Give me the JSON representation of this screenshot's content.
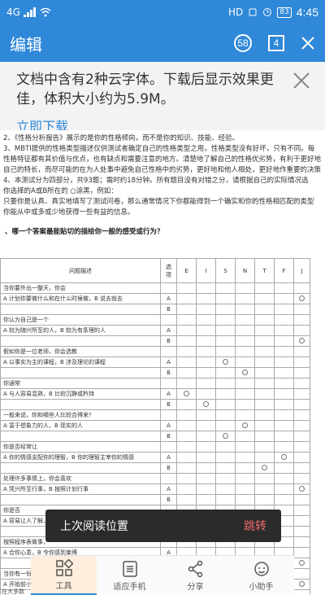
{
  "status_bar": {
    "carrier": "4G",
    "hd": "HD",
    "battery": "83",
    "time": "4:45"
  },
  "topbar": {
    "title": "编辑",
    "notif_count": "58",
    "page_count": "4"
  },
  "banner": {
    "message": "文档中含有2种云字体。下载后显示效果更佳，体积大小约为5.9M。",
    "download": "立即下载"
  },
  "doc": {
    "lines": [
      "2、《性格分析报告》展示的是你的性格倾向，而不是你的知识、技能、经验。",
      "3、MBTI提供的性格类型描述仅供测试者确定自己的性格类型之用，性格类型没有好坏，只有不同。每",
      "性格特征都有其价值与优点，也有缺点和需要注意的地方。清楚地了解自己的性格优劣势，有利于更好地",
      "自己的特长，而尽可能的在为人处事中避免自己性格中的劣势，更好地和他人相处，更好地作重要的决策",
      "4、本测试分为四部分，共93题；需时约18分钟。所有题目没有对错之分，请根据自己的实际情况选",
      "你选择的A或B所在的 ○涂黑，例如：",
      "只要你是认真、真实地填写了测试问卷，那么通常情况下你都能得到一个确实和你的性格相匹配的类型",
      "你能从中或多或少地获得一些有益的信息。"
    ],
    "question_title": "、哪一个答案最能贴切的描绘你一般的感受或行为？",
    "table_header": [
      "问题描述",
      "选项",
      "E",
      "I",
      "S",
      "N",
      "T",
      "F",
      "J"
    ],
    "rows": [
      {
        "q": "当你要外出一整天，你会",
        "a": "A 计划你要做什么和在什么时候做，B 说去就去",
        "marks": [
          8,
          null
        ]
      },
      {
        "q": "你认为自己是一个",
        "a": "A 较为随兴所至的人，B 较为有条理的人",
        "marks": [
          null,
          8
        ]
      },
      {
        "q": "假如你是一位老师，你会选教",
        "a": "A 以事实为主的课程，B 涉及理论的课程",
        "marks": [
          4,
          5
        ]
      },
      {
        "q": "你通常",
        "a": "A 与人容易混熟，B 比较沉静或矜持",
        "marks": [
          2,
          3
        ]
      },
      {
        "q": "一般来说，你和哪些人比较合得来?",
        "a": "A 富于想象力的人，B 现实的人",
        "marks": [
          5,
          4
        ]
      },
      {
        "q": "你是否经常让",
        "a": "A 你的情感支配你的理智，B 你的理智主宰你的情感",
        "marks": [
          7,
          6
        ]
      },
      {
        "q": "处理许多事情上，你会喜欢",
        "a": "A 凭兴所至行事，B 按照计划行事",
        "marks": [
          8,
          null
        ]
      },
      {
        "q": "你是否",
        "a": "A 容易让人了解，或是 B 难于让人了解",
        "marks": [
          2,
          3
        ]
      },
      {
        "q": "按照程序表做事，",
        "a": "A 合你心意，B 令你感到束缚",
        "marks": [
          null,
          8
        ]
      },
      {
        "q": "当你有一份特别的任务，你会喜欢",
        "a": "A 开始前小心组织计划，B 边做边找须做什么",
        "marks": [
          8,
          null
        ]
      }
    ],
    "footer_fragment": "在大多数"
  },
  "toast": {
    "text": "上次阅读位置",
    "action": "跳转"
  },
  "bottom_tabs": [
    {
      "label": "工具",
      "icon": "tools-icon"
    },
    {
      "label": "适应手机",
      "icon": "fit-phone-icon"
    },
    {
      "label": "分享",
      "icon": "share-icon"
    },
    {
      "label": "小助手",
      "icon": "assistant-icon"
    }
  ],
  "colors": {
    "primary": "#2f88d8",
    "toast_action": "#f06a6a"
  }
}
